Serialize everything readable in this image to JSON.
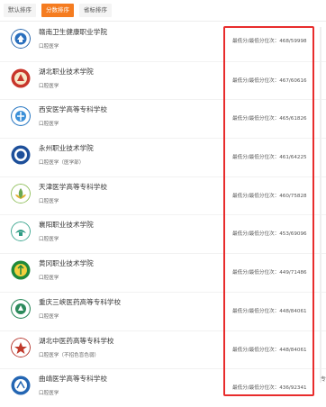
{
  "tabs": [
    {
      "label": "默认排序",
      "active": false
    },
    {
      "label": "分数排序",
      "active": true
    },
    {
      "label": "省标排序",
      "active": false
    }
  ],
  "colors": {
    "accent": "#f57c20",
    "highlight": "#e82c2c"
  },
  "schools": [
    {
      "name": "赣南卫生健康职业学院",
      "sub": "口腔医学",
      "score": "最低分/最低分位次：468/59998"
    },
    {
      "name": "湖北职业技术学院",
      "sub": "口腔医学",
      "score": "最低分/最低分位次：467/60616"
    },
    {
      "name": "西安医学高等专科学校",
      "sub": "口腔医学",
      "score": "最低分/最低分位次：465/61826"
    },
    {
      "name": "永州职业技术学院",
      "sub": "口腔医学（医学部）",
      "score": "最低分/最低分位次：461/64225"
    },
    {
      "name": "天津医学高等专科学校",
      "sub": "口腔医学",
      "score": "最低分/最低分位次：460/75828"
    },
    {
      "name": "襄阳职业技术学院",
      "sub": "口腔医学",
      "score": "最低分/最低分位次：453/69096"
    },
    {
      "name": "黄冈职业技术学院",
      "sub": "口腔医学",
      "score": "最低分/最低分位次：449/71486"
    },
    {
      "name": "重庆三峡医药高等专科学校",
      "sub": "口腔医学",
      "score": "最低分/最低分位次：448/84061"
    },
    {
      "name": "湖北中医药高等专科学校",
      "sub": "口腔医学（不招色盲色弱）",
      "score": "最低分/最低分位次：448/84061"
    },
    {
      "name": "曲靖医学高等专科学校",
      "sub": "口腔医学",
      "score": "最低分/最低分位次：436/92341"
    }
  ],
  "edge_glyph": "专"
}
